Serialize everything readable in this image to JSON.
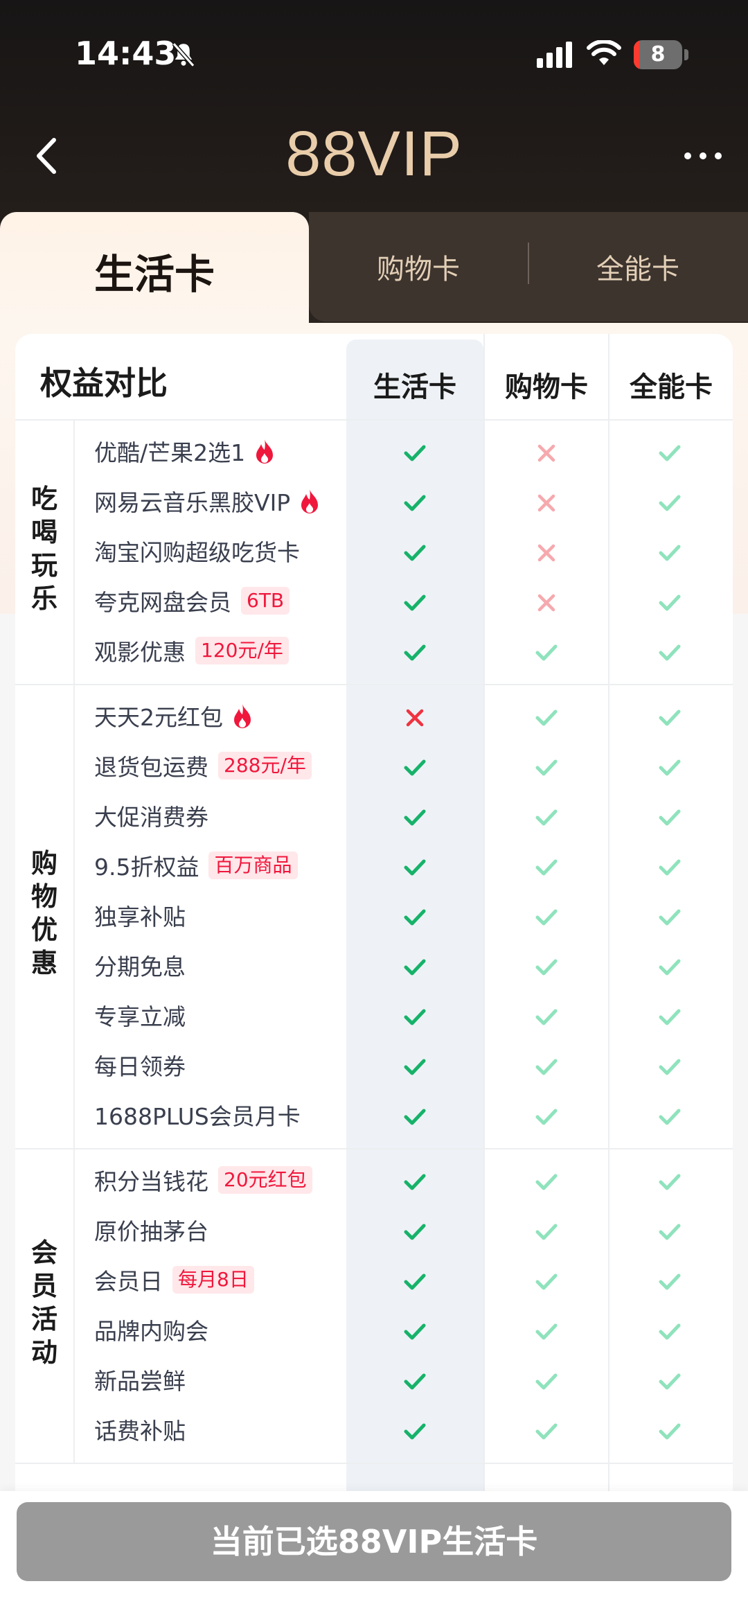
{
  "status_bar": {
    "time": "14:43",
    "battery": "8"
  },
  "nav": {
    "title": "88VIP"
  },
  "tabs": [
    {
      "label": "生活卡",
      "active": true
    },
    {
      "label": "购物卡",
      "active": false
    },
    {
      "label": "全能卡",
      "active": false
    }
  ],
  "table": {
    "title": "权益对比",
    "columns": [
      "生活卡",
      "购物卡",
      "全能卡"
    ],
    "categories": [
      {
        "name": "吃喝玩乐",
        "rows": [
          {
            "label": "优酷/芒果2选1",
            "badge": "",
            "hot": true,
            "marks": [
              "check",
              "cross",
              "check"
            ]
          },
          {
            "label": "网易云音乐黑胶VIP",
            "badge": "",
            "hot": true,
            "marks": [
              "check",
              "cross",
              "check"
            ]
          },
          {
            "label": "淘宝闪购超级吃货卡",
            "badge": "",
            "hot": false,
            "marks": [
              "check",
              "cross",
              "check"
            ]
          },
          {
            "label": "夸克网盘会员",
            "badge": "6TB",
            "hot": false,
            "marks": [
              "check",
              "cross",
              "check"
            ]
          },
          {
            "label": "观影优惠",
            "badge": "120元/年",
            "hot": false,
            "marks": [
              "check",
              "check",
              "check"
            ]
          }
        ]
      },
      {
        "name": "购物优惠",
        "rows": [
          {
            "label": "天天2元红包",
            "badge": "",
            "hot": true,
            "marks": [
              "cross",
              "check",
              "check"
            ]
          },
          {
            "label": "退货包运费",
            "badge": "288元/年",
            "hot": false,
            "marks": [
              "check",
              "check",
              "check"
            ]
          },
          {
            "label": "大促消费券",
            "badge": "",
            "hot": false,
            "marks": [
              "check",
              "check",
              "check"
            ]
          },
          {
            "label": "9.5折权益",
            "badge": "百万商品",
            "hot": false,
            "marks": [
              "check",
              "check",
              "check"
            ]
          },
          {
            "label": "独享补贴",
            "badge": "",
            "hot": false,
            "marks": [
              "check",
              "check",
              "check"
            ]
          },
          {
            "label": "分期免息",
            "badge": "",
            "hot": false,
            "marks": [
              "check",
              "check",
              "check"
            ]
          },
          {
            "label": "专享立减",
            "badge": "",
            "hot": false,
            "marks": [
              "check",
              "check",
              "check"
            ]
          },
          {
            "label": "每日领券",
            "badge": "",
            "hot": false,
            "marks": [
              "check",
              "check",
              "check"
            ]
          },
          {
            "label": "1688PLUS会员月卡",
            "badge": "",
            "hot": false,
            "marks": [
              "check",
              "check",
              "check"
            ]
          }
        ]
      },
      {
        "name": "会员活动",
        "rows": [
          {
            "label": "积分当钱花",
            "badge": "20元红包",
            "hot": false,
            "marks": [
              "check",
              "check",
              "check"
            ]
          },
          {
            "label": "原价抽茅台",
            "badge": "",
            "hot": false,
            "marks": [
              "check",
              "check",
              "check"
            ]
          },
          {
            "label": "会员日",
            "badge": "每月8日",
            "hot": false,
            "marks": [
              "check",
              "check",
              "check"
            ]
          },
          {
            "label": "品牌内购会",
            "badge": "",
            "hot": false,
            "marks": [
              "check",
              "check",
              "check"
            ]
          },
          {
            "label": "新品尝鲜",
            "badge": "",
            "hot": false,
            "marks": [
              "check",
              "check",
              "check"
            ]
          },
          {
            "label": "话费补贴",
            "badge": "",
            "hot": false,
            "marks": [
              "check",
              "check",
              "check"
            ]
          }
        ]
      }
    ]
  },
  "footer": {
    "button_label": "当前已选88VIP生活卡"
  },
  "colors": {
    "check_primary": "#17b26a",
    "check_secondary": "#8fe3bc",
    "cross_primary": "#ef3340",
    "cross_secondary": "#f6a9ae",
    "gold": "#e9cdaa",
    "button_gray": "#9a9a9a"
  },
  "icons": [
    "back-arrow-icon",
    "more-dots-icon",
    "bell-slash-icon",
    "signal-icon",
    "wifi-icon",
    "battery-icon",
    "fire-icon",
    "check-icon",
    "cross-icon"
  ]
}
